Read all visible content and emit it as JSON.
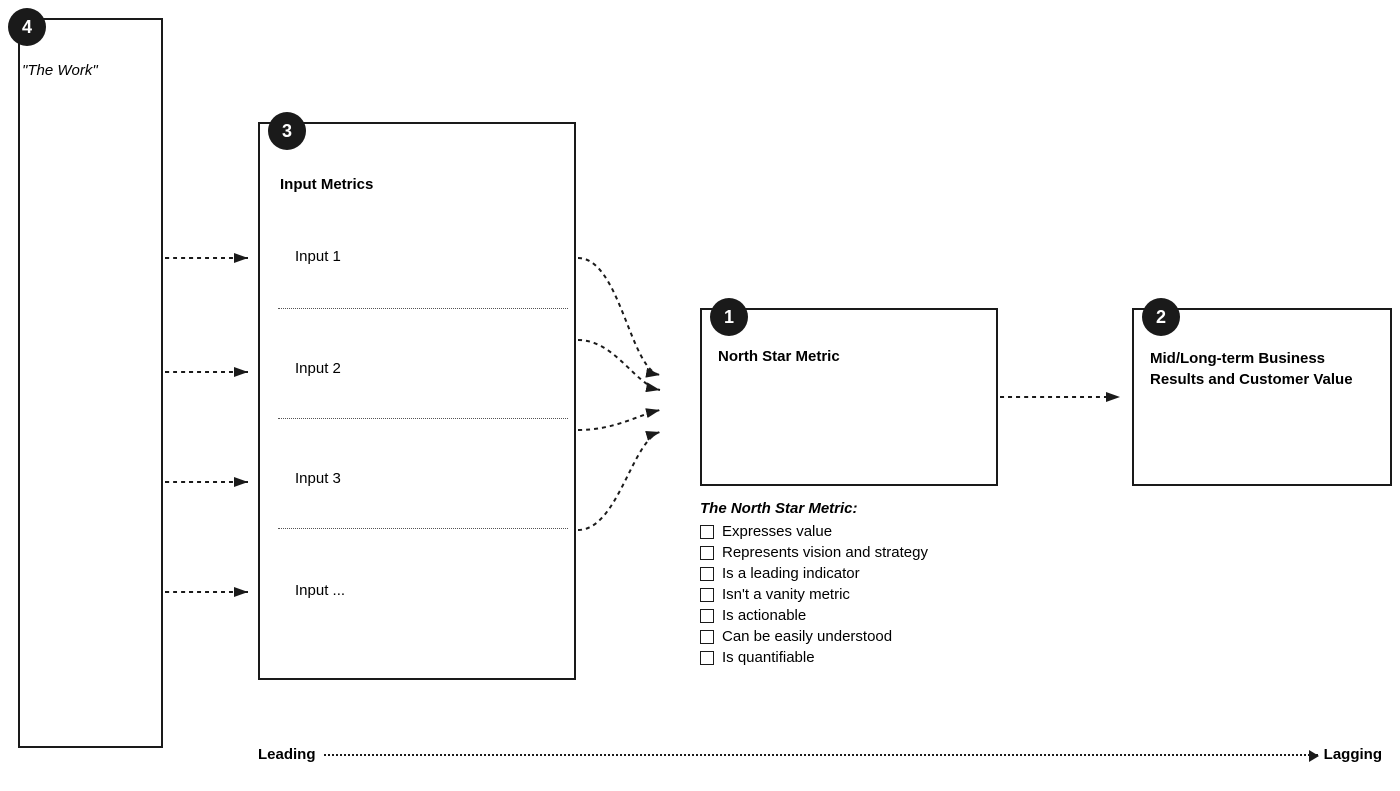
{
  "badges": {
    "b4": "4",
    "b3": "3",
    "b1": "1",
    "b2": "2"
  },
  "labels": {
    "work": "\"The Work\"",
    "input_metrics": "Input Metrics",
    "north_star": "North Star Metric",
    "mid_long": "Mid/Long-term Business\nResults and Customer Value",
    "mid_long_line1": "Mid/Long-term Business",
    "mid_long_line2": "Results and Customer Value",
    "nsm_title": "The North Star Metric:",
    "leading": "Leading",
    "lagging": "Lagging"
  },
  "inputs": [
    "Input 1",
    "Input 2",
    "Input 3",
    "Input ..."
  ],
  "criteria": [
    "Expresses value",
    "Represents vision and strategy",
    "Is a leading indicator",
    "Isn't a vanity metric",
    "Is actionable",
    "Can be easily understood",
    "Is quantifiable"
  ]
}
